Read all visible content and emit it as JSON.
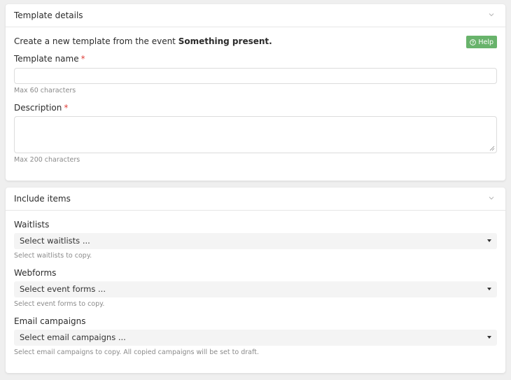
{
  "template_details": {
    "title": "Template details",
    "intro_prefix": "Create a new template from the event ",
    "event_name": "Something present.",
    "help_label": "Help",
    "name_field": {
      "label": "Template name",
      "required_mark": "*",
      "value": "",
      "hint": "Max 60 characters"
    },
    "description_field": {
      "label": "Description",
      "required_mark": "*",
      "value": "",
      "hint": "Max 200 characters"
    }
  },
  "include_items": {
    "title": "Include items",
    "waitlists": {
      "label": "Waitlists",
      "selected": "Select waitlists ...",
      "hint": "Select waitlists to copy."
    },
    "webforms": {
      "label": "Webforms",
      "selected": "Select event forms ...",
      "hint": "Select event forms to copy."
    },
    "email_campaigns": {
      "label": "Email campaigns",
      "selected": "Select email campaigns ...",
      "hint": "Select email campaigns to copy. All copied campaigns will be set to draft."
    }
  },
  "colors": {
    "help_button": "#68b36b",
    "required": "#e0413c",
    "background": "#efefef"
  }
}
